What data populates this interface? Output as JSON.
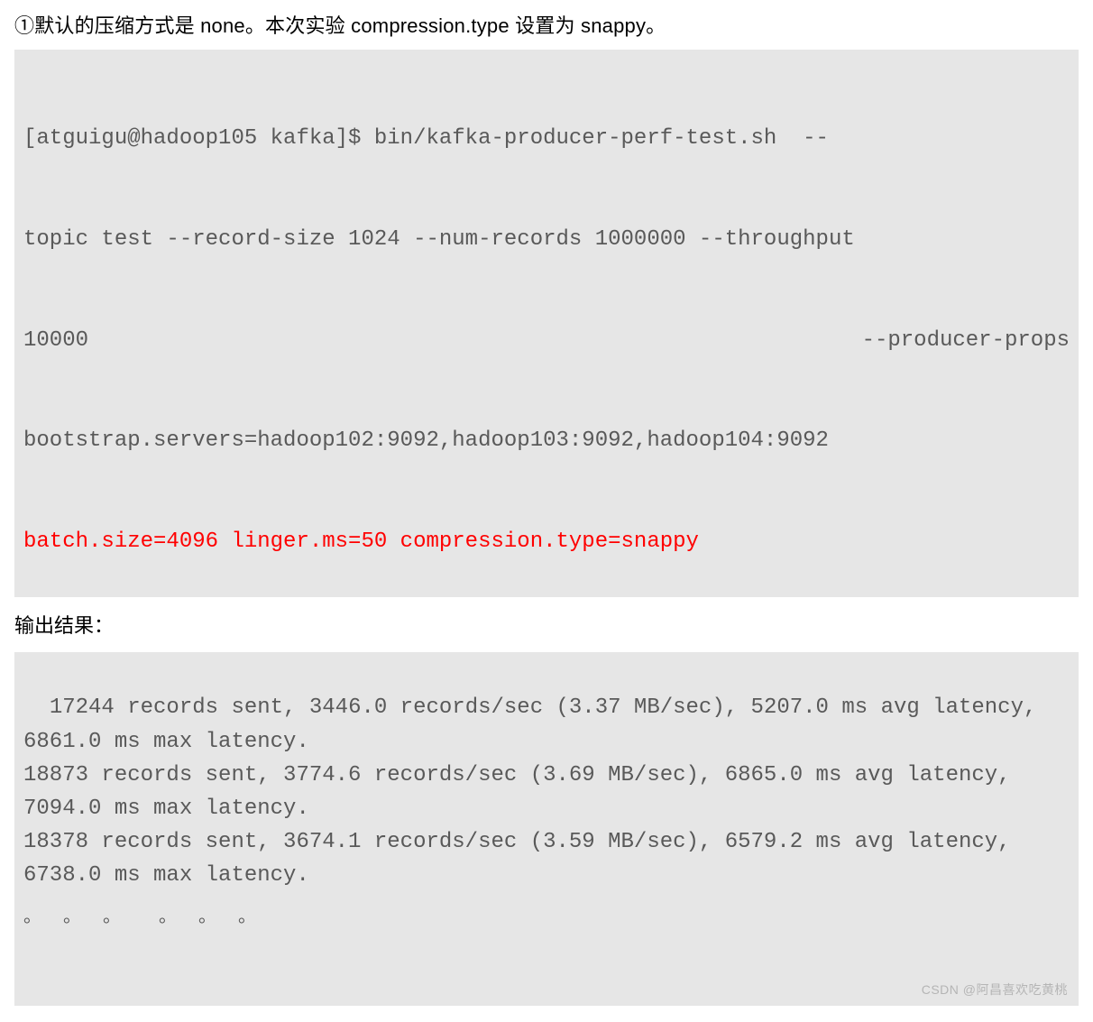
{
  "intro": "①默认的压缩方式是 none。本次实验 compression.type 设置为 snappy。",
  "command": {
    "line1": "[atguigu@hadoop105 kafka]$ bin/kafka-producer-perf-test.sh  --",
    "line2": "topic test --record-size 1024 --num-records 1000000 --throughput",
    "line3_left": "10000",
    "line3_right": "--producer-props",
    "line4": "bootstrap.servers=hadoop102:9092,hadoop103:9092,hadoop104:9092",
    "highlight": "batch.size=4096 linger.ms=50 compression.type=snappy"
  },
  "subhead": "输出结果：",
  "output": {
    "line1": "17244 records sent, 3446.0 records/sec (3.37 MB/sec), 5207.0 ms avg latency,",
    "line2": "6861.0 ms max latency.",
    "line3": "18873 records sent, 3774.6 records/sec (3.69 MB/sec), 6865.0 ms avg latency,",
    "line4": "7094.0 ms max latency.",
    "line5": "18378 records sent, 3674.1 records/sec (3.59 MB/sec), 6579.2 ms avg latency,",
    "line6": "6738.0 ms max latency.",
    "dots": "。 。 。  。 。 。"
  },
  "watermark": "CSDN @阿昌喜欢吃黄桃"
}
